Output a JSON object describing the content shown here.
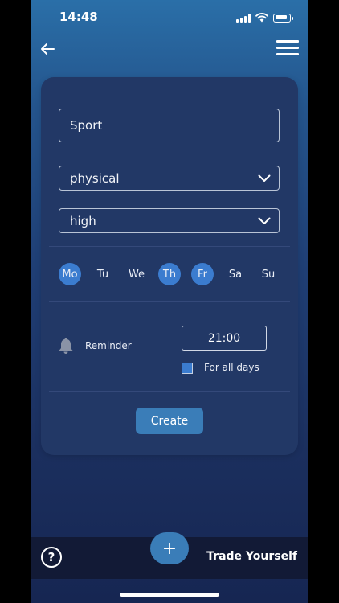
{
  "status": {
    "time": "14:48"
  },
  "form": {
    "name_value": "Sport",
    "type_selected": "physical",
    "priority_selected": "high"
  },
  "days": [
    {
      "label": "Mo",
      "active": true
    },
    {
      "label": "Tu",
      "active": false
    },
    {
      "label": "We",
      "active": false
    },
    {
      "label": "Th",
      "active": true
    },
    {
      "label": "Fr",
      "active": true
    },
    {
      "label": "Sa",
      "active": false
    },
    {
      "label": "Su",
      "active": false
    }
  ],
  "reminder": {
    "label": "Reminder",
    "time_value": "21:00",
    "all_days_label": "For all days",
    "all_days_checked": true
  },
  "actions": {
    "create_label": "Create"
  },
  "bottom_bar": {
    "help_label": "?",
    "add_label": "+",
    "brand": "Trade Yourself"
  },
  "colors": {
    "accent": "#3b7ccf",
    "button": "#3a7db8",
    "card": "#223866"
  }
}
